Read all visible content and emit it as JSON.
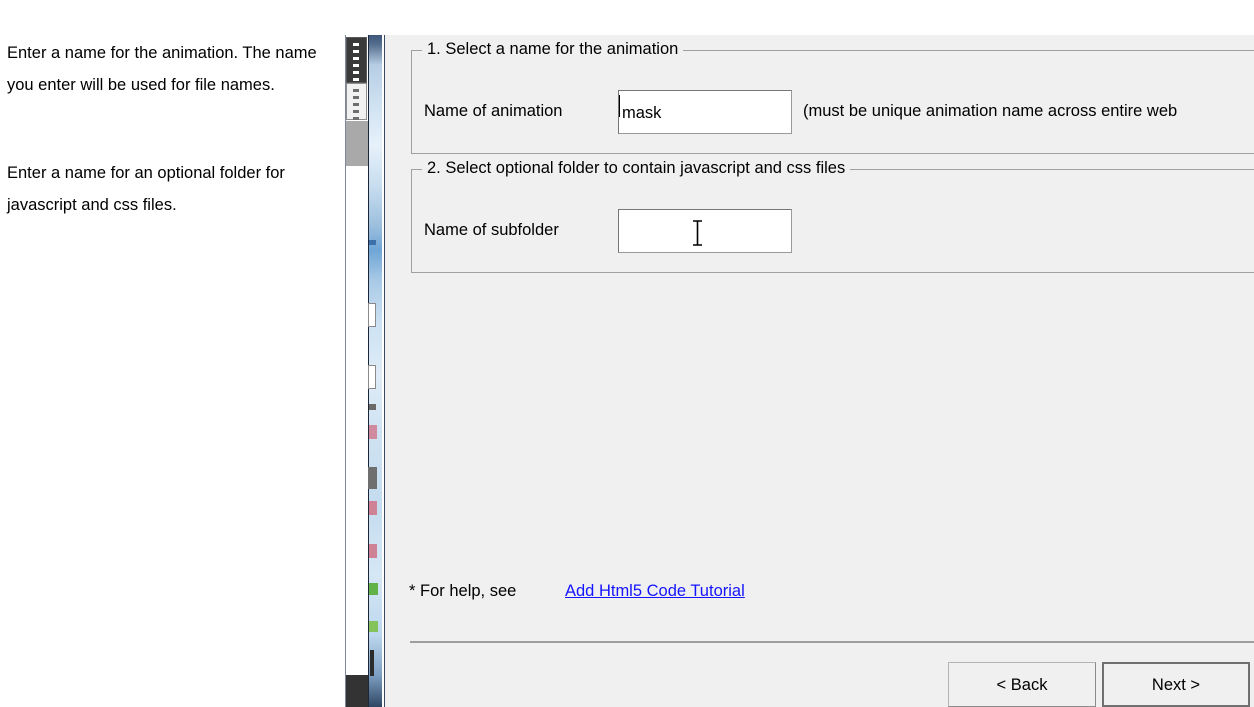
{
  "help_pane": {
    "paragraph_1": "Enter a name for the animation. The name you enter will be used for file names.",
    "paragraph_2": "Enter a name for an optional folder for javascript and css files."
  },
  "dialog": {
    "group_1": {
      "title": "1. Select a name for the animation",
      "field_label": "Name of animation",
      "field_value": "mask",
      "field_placeholder": "",
      "note": "(must be unique animation name across entire web"
    },
    "group_2": {
      "title": "2. Select optional folder to contain javascript and css files",
      "field_label": "Name of subfolder",
      "field_value": "",
      "field_placeholder": ""
    },
    "footer": {
      "help_prefix": "* For help, see",
      "help_link": "Add Html5 Code Tutorial",
      "back_button": "< Back",
      "next_button": "Next >"
    }
  },
  "colors": {
    "dialog_background": "#f0f0f0",
    "groupbox_border": "#a0a0a0",
    "link": "#1414ff",
    "text": "#000000",
    "textbox_background": "#ffffff",
    "separator": "#9e9e9e",
    "default_button_border": "#707070"
  }
}
